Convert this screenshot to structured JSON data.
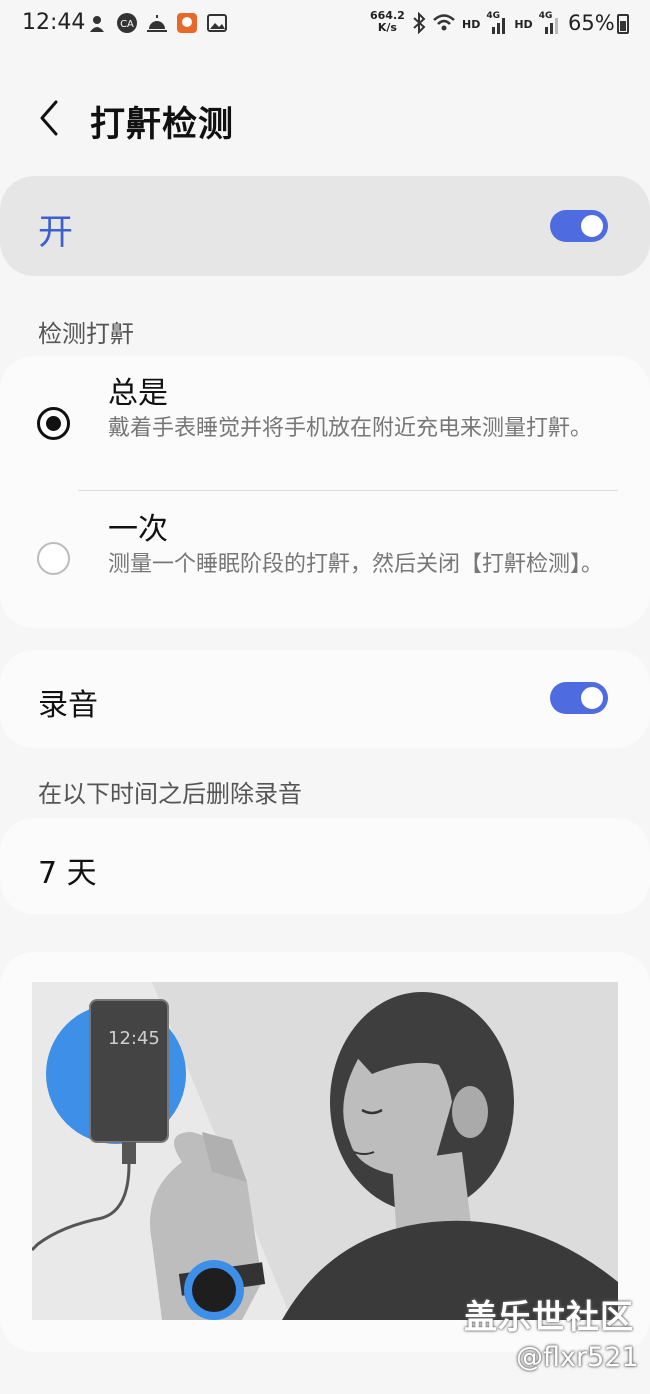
{
  "status_bar": {
    "time": "12:44",
    "net_speed_value": "664.2",
    "net_speed_unit": "K/s",
    "signal_1": "HD",
    "signal_1_gen": "4G",
    "signal_2": "HD",
    "signal_2_gen": "4G",
    "battery": "65%"
  },
  "header": {
    "title": "打鼾检测"
  },
  "master": {
    "label": "开",
    "enabled": true
  },
  "detect_section": {
    "label": "检测打鼾",
    "options": [
      {
        "title": "总是",
        "description": "戴着手表睡觉并将手机放在附近充电来测量打鼾。",
        "selected": true
      },
      {
        "title": "一次",
        "description": "测量一个睡眠阶段的打鼾，然后关闭【打鼾检测】。",
        "selected": false
      }
    ]
  },
  "recording": {
    "label": "录音",
    "enabled": true
  },
  "delete_section": {
    "label": "在以下时间之后删除录音",
    "value": "7 天"
  },
  "illustration": {
    "phone_time": "12:45"
  },
  "watermark": {
    "line1": "盖乐世社区",
    "line2": "@flxr521"
  },
  "colors": {
    "accent": "#4f6be0",
    "charger_blue": "#3d8fe8"
  }
}
